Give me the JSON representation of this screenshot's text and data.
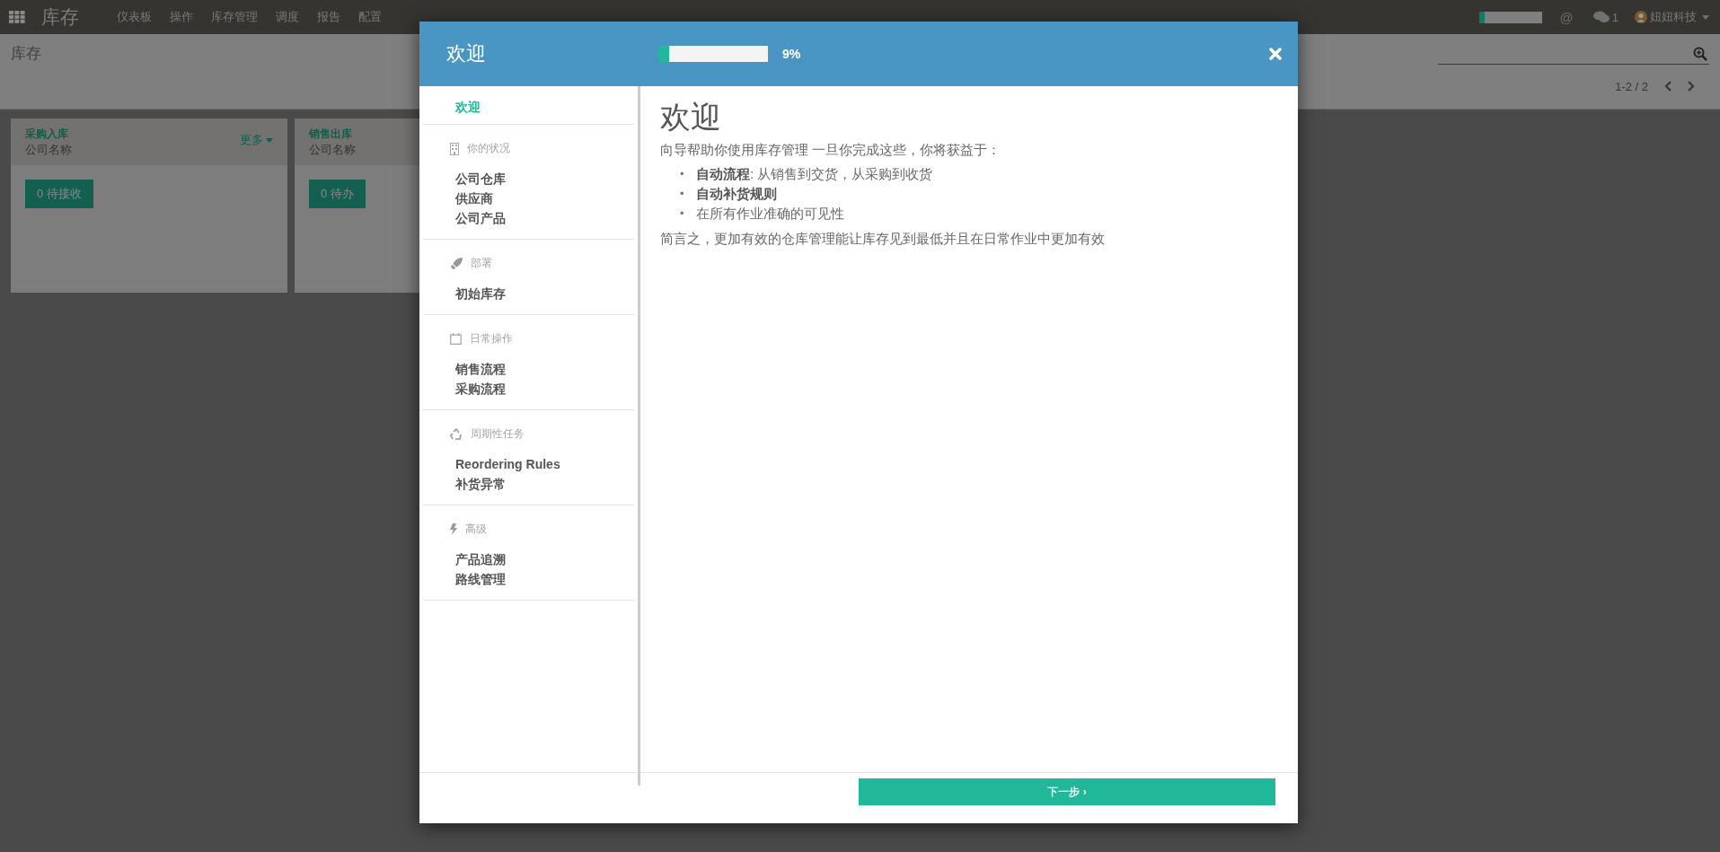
{
  "topbar": {
    "app_title": "库存",
    "menu": [
      "仪表板",
      "操作",
      "库存管理",
      "调度",
      "报告",
      "配置"
    ],
    "progress": {
      "level": 0.09
    },
    "mention_icon": "@",
    "chat_count": "1",
    "user": "妞妞科技"
  },
  "control_panel": {
    "breadcrumb": "库存",
    "pager": "1-2 / 2"
  },
  "cards": [
    {
      "title": "采购入库",
      "company": "公司名称",
      "more": "更多",
      "button": "0 待接收"
    },
    {
      "title": "销售出库",
      "company": "公司名称",
      "button": "0 待办"
    }
  ],
  "modal": {
    "title": "欢迎",
    "progress": {
      "level": 0.09,
      "reading": "9%"
    },
    "sidebar": [
      {
        "items": [
          {
            "label": "欢迎",
            "selected": true
          }
        ]
      },
      {
        "title": "你的状况",
        "items": [
          {
            "label": "公司仓库",
            "selected": false
          },
          {
            "label": "供应商",
            "selected": false
          },
          {
            "label": "公司产品",
            "selected": false
          }
        ]
      },
      {
        "title": "部署",
        "items": [
          {
            "label": "初始库存",
            "selected": false
          }
        ]
      },
      {
        "title": "日常操作",
        "items": [
          {
            "label": "销售流程",
            "selected": false
          },
          {
            "label": "采购流程",
            "selected": false
          }
        ]
      },
      {
        "title": "周期性任务",
        "items": [
          {
            "label": "Reordering Rules",
            "selected": false
          },
          {
            "label": "补货异常",
            "selected": false
          }
        ]
      },
      {
        "title": "高级",
        "items": [
          {
            "label": "产品追溯",
            "selected": false
          },
          {
            "label": "路线管理",
            "selected": false
          }
        ]
      }
    ],
    "content": {
      "heading": "欢迎",
      "intro": "向导帮助你使用库存管理 一旦你完成这些，你将获益于：",
      "bullets": [
        {
          "marker": "•",
          "text": "**自动流程**: 从销售到交货，从采购到收货"
        },
        {
          "marker": "•",
          "text": "**自动补货规则**"
        },
        {
          "marker": "•",
          "text": "在所有作业准确的可见性"
        }
      ],
      "summary": "简言之，更加有效的仓库管理能让库存见到最低并且在日常作业中更加有效"
    },
    "next_button": "下一步 ›"
  }
}
